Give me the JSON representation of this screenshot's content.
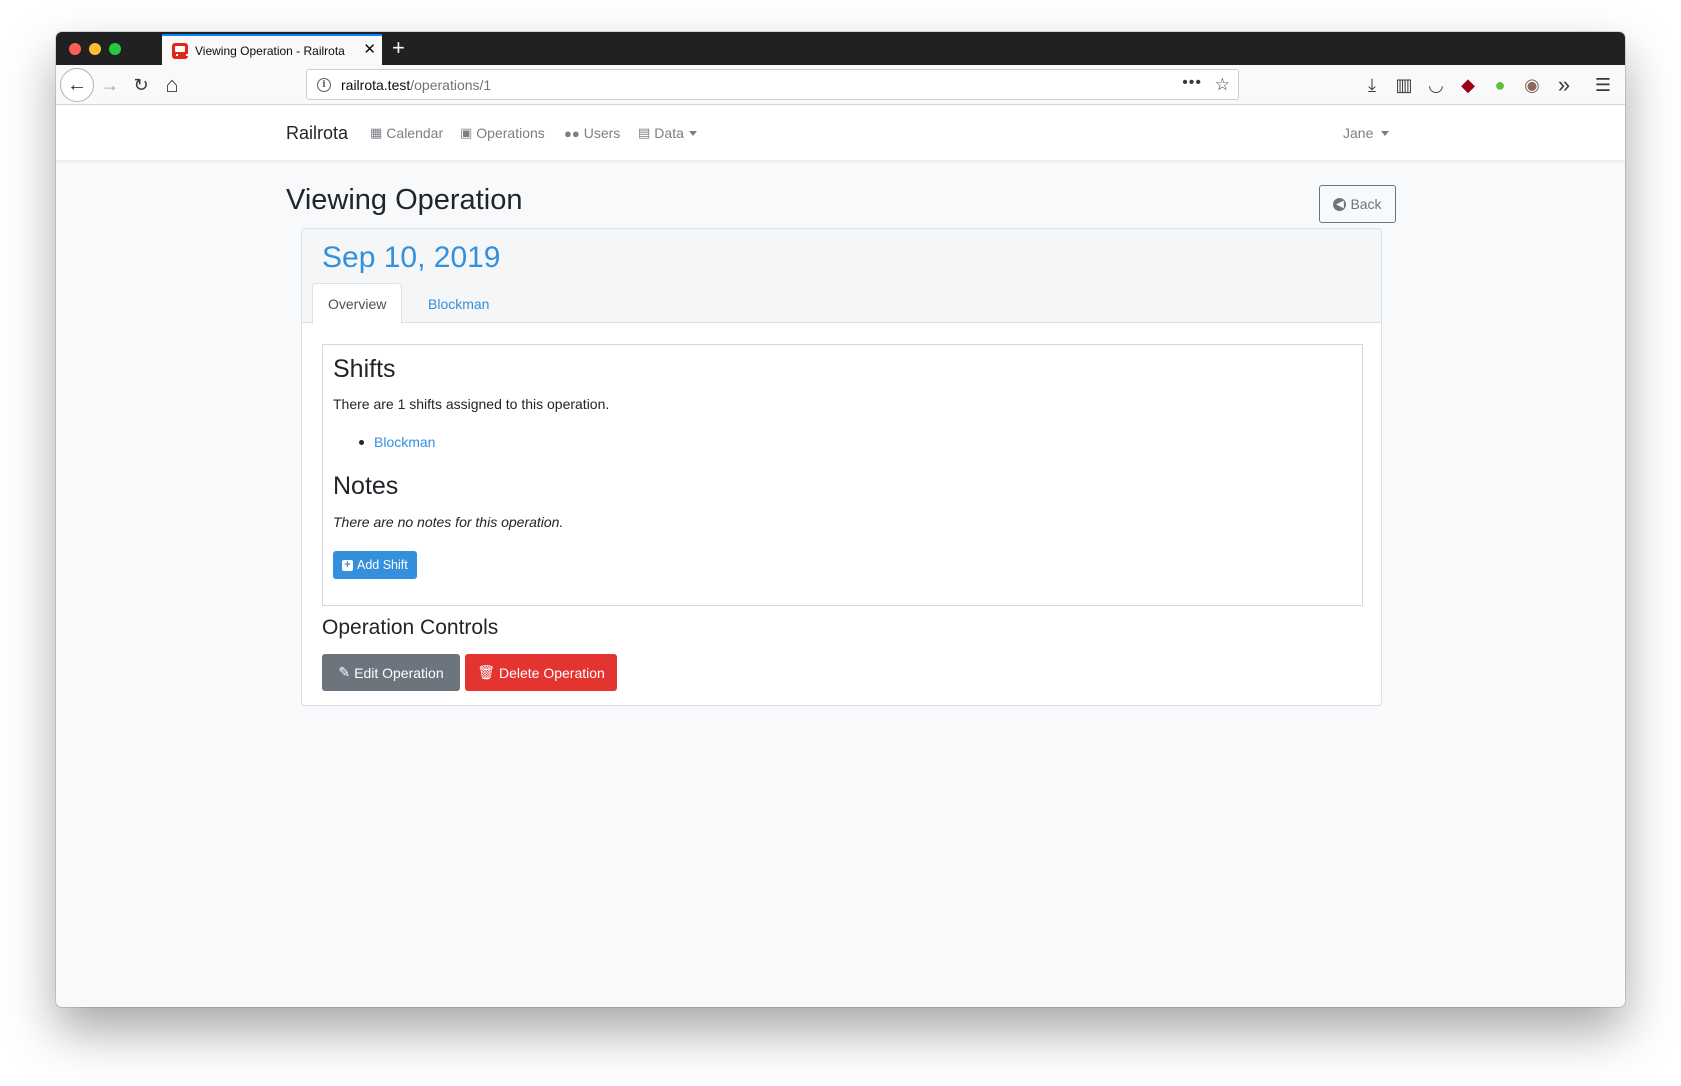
{
  "browser": {
    "tab_title": "Viewing Operation - Railrota",
    "tab_close": "✕",
    "new_tab": "+",
    "url_host": "railrota.test",
    "url_path": "/operations/1",
    "url_more": "•••",
    "icons": {
      "back": "←",
      "forward": "→",
      "reload": "↻",
      "home": "⌂",
      "bookmark": "☆",
      "download": "⤓",
      "sidebar": "▥",
      "pocket": "◡",
      "ublock": "◆",
      "extension": "●",
      "profile": "◉",
      "overflow": "»",
      "menu": "☰"
    }
  },
  "navbar": {
    "brand": "Railrota",
    "items": [
      {
        "label": "Calendar",
        "icon": "calendar-icon"
      },
      {
        "label": "Operations",
        "icon": "train-icon"
      },
      {
        "label": "Users",
        "icon": "users-icon"
      },
      {
        "label": "Data",
        "icon": "table-icon"
      }
    ],
    "user": "Jane"
  },
  "page": {
    "title": "Viewing Operation",
    "back_label": "Back"
  },
  "card": {
    "date": "Sep 10, 2019",
    "tabs": [
      {
        "label": "Overview",
        "active": true
      },
      {
        "label": "Blockman",
        "active": false
      }
    ],
    "shifts_heading": "Shifts",
    "shifts_text": "There are 1 shifts assigned to this operation.",
    "shifts": [
      "Blockman"
    ],
    "notes_heading": "Notes",
    "notes_text": "There are no notes for this operation.",
    "add_shift_label": "Add Shift",
    "controls_heading": "Operation Controls",
    "edit_label": "Edit Operation",
    "delete_label": "Delete Operation"
  },
  "colors": {
    "primary": "#3490dc",
    "secondary": "#6c757d",
    "danger": "#e3342f",
    "chrome_dark": "#212124"
  }
}
